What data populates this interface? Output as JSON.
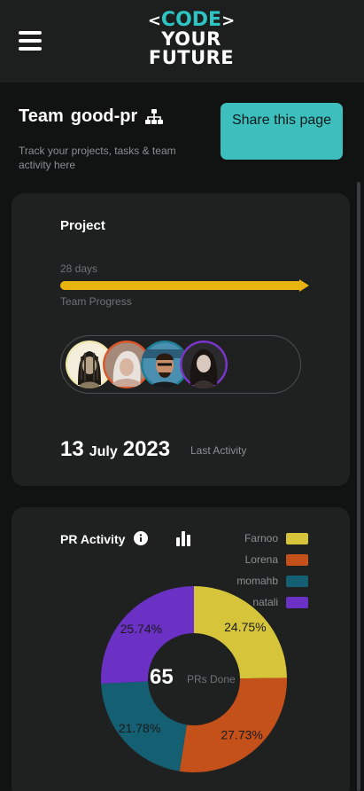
{
  "header": {
    "logo": {
      "line1_left": "<",
      "line1_text": "CODE",
      "line1_right": ">",
      "line2": "YOUR",
      "line3": "FUTURE"
    },
    "menu_icon": "hamburger-icon"
  },
  "team": {
    "title": "Team",
    "name": "good-pr",
    "icon": "sitemap-icon",
    "subtitle": "Track your projects, tasks & team activity here",
    "share_button": "Share this page"
  },
  "project": {
    "title": "Project",
    "days": "28 days",
    "progress_label": "Team Progress",
    "progress_fraction": 1.0,
    "progress_color": "#e8b510",
    "avatars": [
      {
        "name": "avatar-1",
        "ring": "#f2e9b0"
      },
      {
        "name": "avatar-2",
        "ring": "#d9572b"
      },
      {
        "name": "avatar-3",
        "ring": "#1f7e95"
      },
      {
        "name": "avatar-4",
        "ring": "#7a35c9"
      }
    ],
    "last_date": {
      "day": "13",
      "month": "July",
      "year": "2023"
    },
    "last_activity_label": "Last Activity"
  },
  "pr_activity": {
    "title": "PR Activity",
    "total": "65",
    "total_label": "PRs Done",
    "chart_data": {
      "type": "pie",
      "categories": [
        "Farnoo",
        "Lorena",
        "momahb",
        "natali"
      ],
      "values": [
        24.75,
        27.73,
        21.78,
        25.74
      ],
      "labels": [
        "24.75%",
        "27.73%",
        "21.78%",
        "25.74%"
      ],
      "colors": [
        "#d6c53a",
        "#c4501a",
        "#155f72",
        "#6a31c4"
      ],
      "legend_position": "top-right"
    }
  }
}
